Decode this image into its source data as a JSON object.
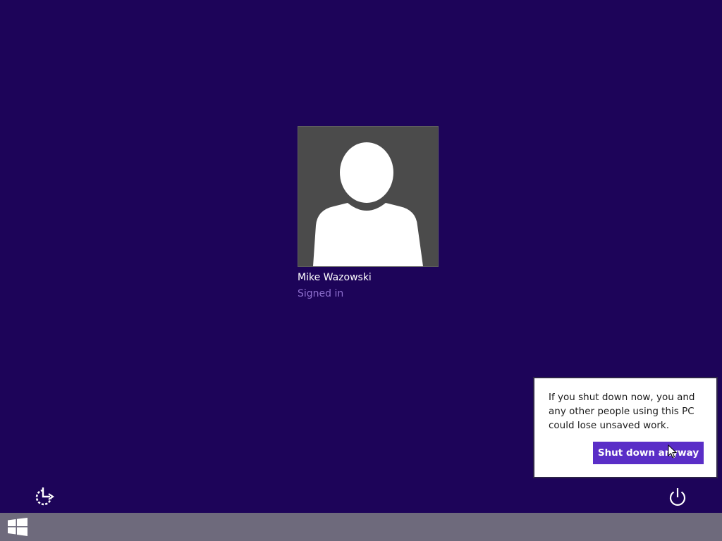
{
  "colors": {
    "background": "#1d0459",
    "tile": "#4b4b4b",
    "status_text": "#8f70cf",
    "accent_button": "#5a2ec7",
    "taskbar": "#6e6a7c"
  },
  "user": {
    "name": "Mike Wazowski",
    "status": "Signed in",
    "avatar_icon": "default-user-silhouette-icon"
  },
  "shutdown_warning": {
    "message": "If you shut down now, you and any other people using this PC could lose unsaved work.",
    "button_label": "Shut down anyway"
  },
  "controls": {
    "ease_of_access_icon": "ease-of-access-icon",
    "power_icon": "power-icon"
  },
  "taskbar": {
    "start_icon": "windows-logo-icon"
  }
}
